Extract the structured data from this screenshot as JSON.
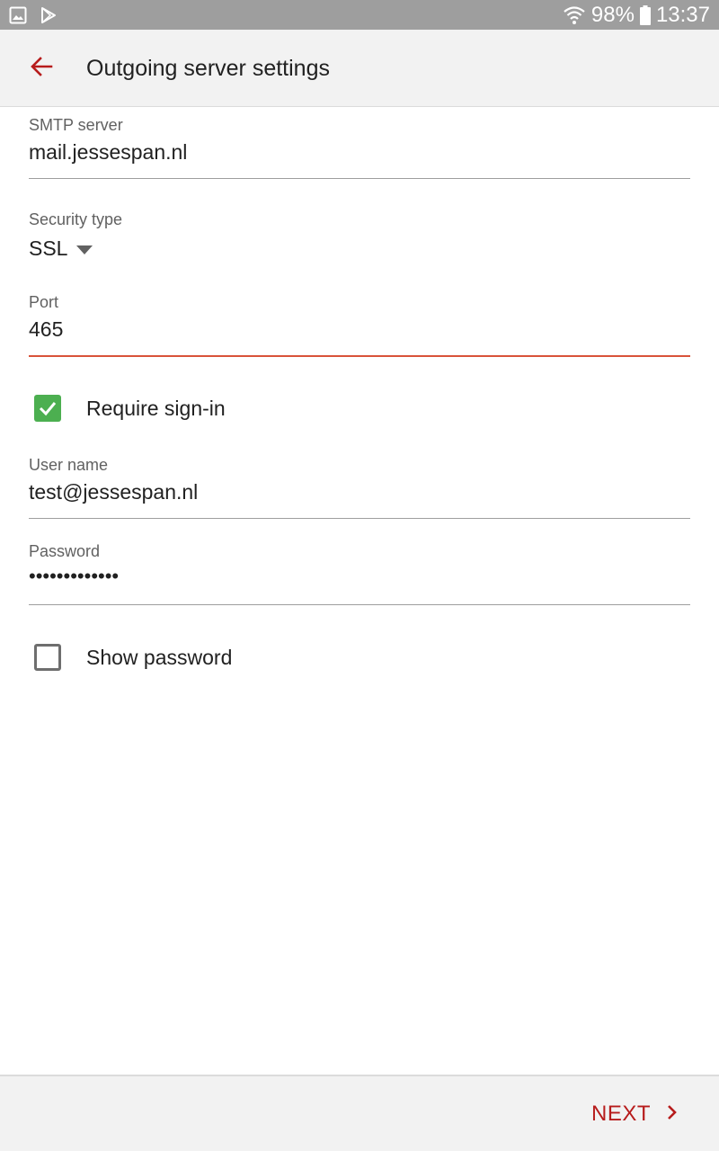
{
  "status_bar": {
    "battery_percent": "98%",
    "time": "13:37",
    "icons": [
      "gallery-icon",
      "play-store-icon",
      "wifi-icon",
      "battery-icon"
    ]
  },
  "app_bar": {
    "title": "Outgoing server settings",
    "back_icon": "arrow-back-icon"
  },
  "form": {
    "smtp_server": {
      "label": "SMTP server",
      "value": "mail.jessespan.nl"
    },
    "security_type": {
      "label": "Security type",
      "value": "SSL"
    },
    "port": {
      "label": "Port",
      "value": "465"
    },
    "require_sign_in": {
      "label": "Require sign-in",
      "checked": true
    },
    "user_name": {
      "label": "User name",
      "value": "test@jessespan.nl"
    },
    "password": {
      "label": "Password",
      "value": "•••••••••••••"
    },
    "show_password": {
      "label": "Show password",
      "checked": false
    }
  },
  "footer": {
    "next_label": "NEXT"
  },
  "colors": {
    "accent": "#b71c1c",
    "active_underline": "#d9533a",
    "checkbox_checked": "#4caf50",
    "status_bar": "#9e9e9e",
    "app_bar": "#f2f2f2"
  }
}
